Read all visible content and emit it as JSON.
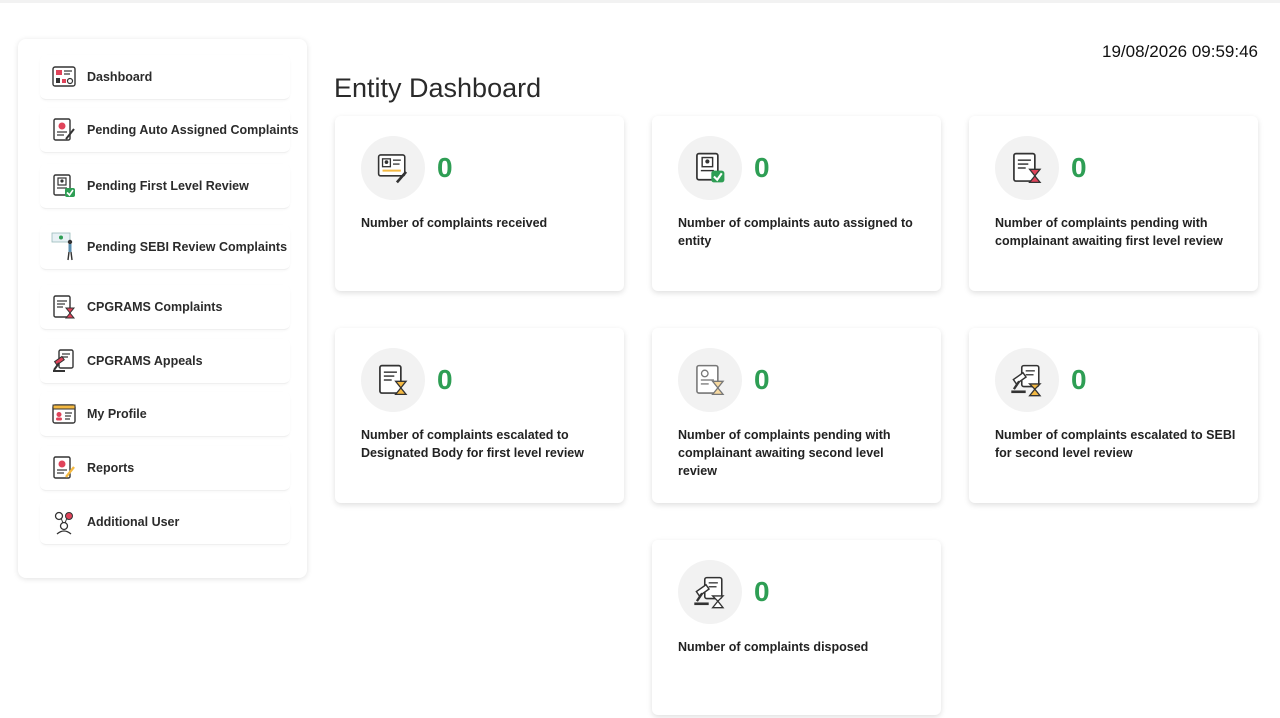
{
  "datetime": "19/08/2026 09:59:46",
  "page_title": "Entity Dashboard",
  "sidebar": {
    "items": [
      {
        "label": "Dashboard",
        "icon": "dashboard-icon"
      },
      {
        "label": "Pending Auto Assigned Complaints",
        "icon": "document-pen-icon"
      },
      {
        "label": "Pending First Level Review",
        "icon": "document-check-icon"
      },
      {
        "label": "Pending SEBI Review Complaints",
        "icon": "person-board-icon"
      },
      {
        "label": "CPGRAMS Complaints",
        "icon": "document-hourglass-icon"
      },
      {
        "label": "CPGRAMS Appeals",
        "icon": "gavel-document-icon"
      },
      {
        "label": "My Profile",
        "icon": "profile-card-icon"
      },
      {
        "label": "Reports",
        "icon": "report-pen-icon"
      },
      {
        "label": "Additional User",
        "icon": "users-icon"
      }
    ]
  },
  "cards": [
    {
      "count": "0",
      "label": "Number of complaints received",
      "icon": "document-pen-icon"
    },
    {
      "count": "0",
      "label": "Number of complaints auto assigned to entity",
      "icon": "document-check-icon"
    },
    {
      "count": "0",
      "label": "Number of complaints pending with complainant awaiting first level review",
      "icon": "document-hourglass-icon"
    },
    {
      "count": "0",
      "label": "Number of complaints escalated to Designated Body for first level review",
      "icon": "document-hourglass-icon"
    },
    {
      "count": "0",
      "label": "Number of complaints pending with complainant awaiting second level review",
      "icon": "document-hourglass-icon"
    },
    {
      "count": "0",
      "label": "Number of complaints escalated to SEBI for second level review",
      "icon": "gavel-hourglass-icon"
    },
    {
      "count": "0",
      "label": "Number of complaints disposed",
      "icon": "gavel-hourglass-icon"
    }
  ],
  "colors": {
    "accent_green": "#2e9e54",
    "icon_red": "#e0435a",
    "icon_dark": "#333333",
    "check_green": "#2e9e54"
  }
}
